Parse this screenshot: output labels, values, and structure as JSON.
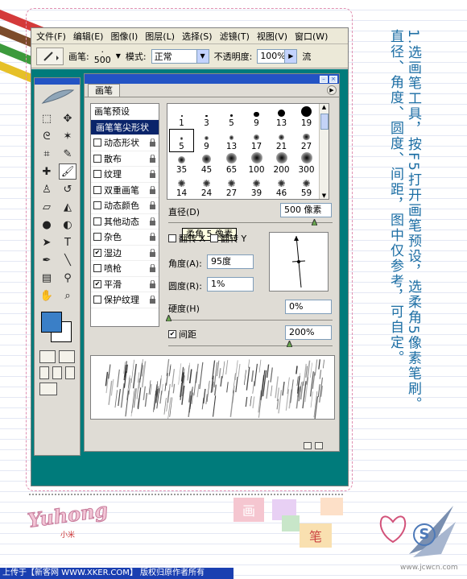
{
  "menubar": {
    "items": [
      "文件(F)",
      "编辑(E)",
      "图像(I)",
      "图层(L)",
      "选择(S)",
      "滤镜(T)",
      "视图(V)",
      "窗口(W)"
    ]
  },
  "options_bar": {
    "brush_label": "画笔:",
    "brush_size": "500",
    "mode_label": "模式:",
    "mode_value": "正常",
    "opacity_label": "不透明度:",
    "opacity_value": "100%",
    "flow_label": "流"
  },
  "palette": {
    "tab_label": "画笔",
    "options_header": "画笔预设",
    "options": [
      {
        "label": "画笔笔尖形状",
        "checkbox": false,
        "checked": false,
        "selected": true
      },
      {
        "label": "动态形状",
        "checkbox": true,
        "checked": false,
        "selected": false
      },
      {
        "label": "散布",
        "checkbox": true,
        "checked": false,
        "selected": false
      },
      {
        "label": "纹理",
        "checkbox": true,
        "checked": false,
        "selected": false
      },
      {
        "label": "双重画笔",
        "checkbox": true,
        "checked": false,
        "selected": false
      },
      {
        "label": "动态颜色",
        "checkbox": true,
        "checked": false,
        "selected": false
      },
      {
        "label": "其他动态",
        "checkbox": true,
        "checked": false,
        "selected": false
      },
      {
        "label": "杂色",
        "checkbox": true,
        "checked": false,
        "selected": false
      },
      {
        "label": "湿边",
        "checkbox": true,
        "checked": true,
        "selected": false
      },
      {
        "label": "喷枪",
        "checkbox": true,
        "checked": false,
        "selected": false
      },
      {
        "label": "平滑",
        "checkbox": true,
        "checked": true,
        "selected": false
      },
      {
        "label": "保护纹理",
        "checkbox": true,
        "checked": false,
        "selected": false
      }
    ],
    "presets": [
      {
        "size": "1",
        "kind": "hard"
      },
      {
        "size": "3",
        "kind": "hard"
      },
      {
        "size": "5",
        "kind": "hard"
      },
      {
        "size": "9",
        "kind": "hard"
      },
      {
        "size": "13",
        "kind": "hard"
      },
      {
        "size": "19",
        "kind": "hard"
      },
      {
        "size": "5",
        "kind": "soft"
      },
      {
        "size": "9",
        "kind": "soft"
      },
      {
        "size": "13",
        "kind": "soft"
      },
      {
        "size": "17",
        "kind": "soft"
      },
      {
        "size": "21",
        "kind": "soft"
      },
      {
        "size": "27",
        "kind": "soft"
      },
      {
        "size": "35",
        "kind": "soft"
      },
      {
        "size": "45",
        "kind": "soft"
      },
      {
        "size": "65",
        "kind": "soft"
      },
      {
        "size": "100",
        "kind": "soft"
      },
      {
        "size": "200",
        "kind": "soft"
      },
      {
        "size": "300",
        "kind": "soft"
      },
      {
        "size": "14",
        "kind": "splatter"
      },
      {
        "size": "24",
        "kind": "splatter"
      },
      {
        "size": "27",
        "kind": "splatter"
      },
      {
        "size": "39",
        "kind": "splatter"
      },
      {
        "size": "46",
        "kind": "splatter"
      },
      {
        "size": "59",
        "kind": "splatter"
      }
    ],
    "tooltip": "柔角 5 像素",
    "diameter_label": "直径(D)",
    "diameter_value": "500 像素",
    "flip_x_label": "翻转 X",
    "flip_y_label": "翻转 Y",
    "angle_label": "角度(A):",
    "angle_value": "95度",
    "roundness_label": "圆度(R):",
    "roundness_value": "1%",
    "hardness_label": "硬度(H)",
    "hardness_value": "0%",
    "spacing_label": "间距",
    "spacing_value": "200%",
    "spacing_checked": true
  },
  "caption": {
    "lines": [
      "1.选画笔工具，按F5打开画笔预设，选柔角5像素笔刷。",
      "直径、角度、圆度、间距，图中仅参考，可自定。"
    ],
    "color": "#1c6ea4"
  },
  "decor": {
    "logo": "Yuhong",
    "logo_sub": "小米",
    "stamp1": "画",
    "stamp2": "笔"
  },
  "footer": {
    "text": "上传于【新客网 WWW.XKER.COM】 版权归原作者所有",
    "watermark": "www.jcwcn.com"
  },
  "colors": {
    "workspace": "#007b7b",
    "foreground": "#3a7fc7",
    "titlebar": "#2353c4",
    "footer_bar": "#1a3fb1"
  }
}
